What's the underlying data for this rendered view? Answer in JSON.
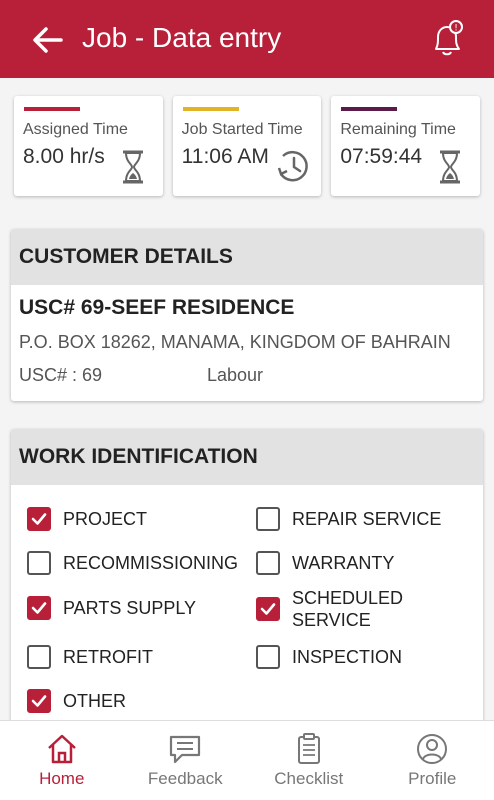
{
  "header": {
    "title": "Job - Data entry"
  },
  "time_cards": [
    {
      "label": "Assigned Time",
      "value": "8.00 hr/s",
      "color": "#b8203a",
      "icon": "hourglass-icon"
    },
    {
      "label": "Job Started Time",
      "value": "11:06 AM",
      "color": "#e2b227",
      "icon": "clock-history-icon"
    },
    {
      "label": "Remaining Time",
      "value": "07:59:44",
      "color": "#5a1b4a",
      "icon": "hourglass-icon"
    }
  ],
  "customer": {
    "heading": "CUSTOMER DETAILS",
    "name": "USC# 69-SEEF RESIDENCE",
    "address": "P.O. BOX 18262, MANAMA, KINGDOM OF BAHRAIN",
    "usc": "USC# : 69",
    "type": "Labour"
  },
  "work": {
    "heading": "WORK IDENTIFICATION",
    "items": [
      {
        "label": "PROJECT",
        "checked": true
      },
      {
        "label": "REPAIR SERVICE",
        "checked": false
      },
      {
        "label": "RECOMMISSIONING",
        "checked": false
      },
      {
        "label": "WARRANTY",
        "checked": false
      },
      {
        "label": "PARTS SUPPLY",
        "checked": true
      },
      {
        "label": "SCHEDULED SERVICE",
        "checked": true
      },
      {
        "label": "RETROFIT",
        "checked": false
      },
      {
        "label": "INSPECTION",
        "checked": false
      },
      {
        "label": "OTHER",
        "checked": true
      }
    ]
  },
  "nav": [
    {
      "label": "Home",
      "active": true
    },
    {
      "label": "Feedback",
      "active": false
    },
    {
      "label": "Checklist",
      "active": false
    },
    {
      "label": "Profile",
      "active": false
    }
  ],
  "colors": {
    "brand": "#b8203a"
  }
}
